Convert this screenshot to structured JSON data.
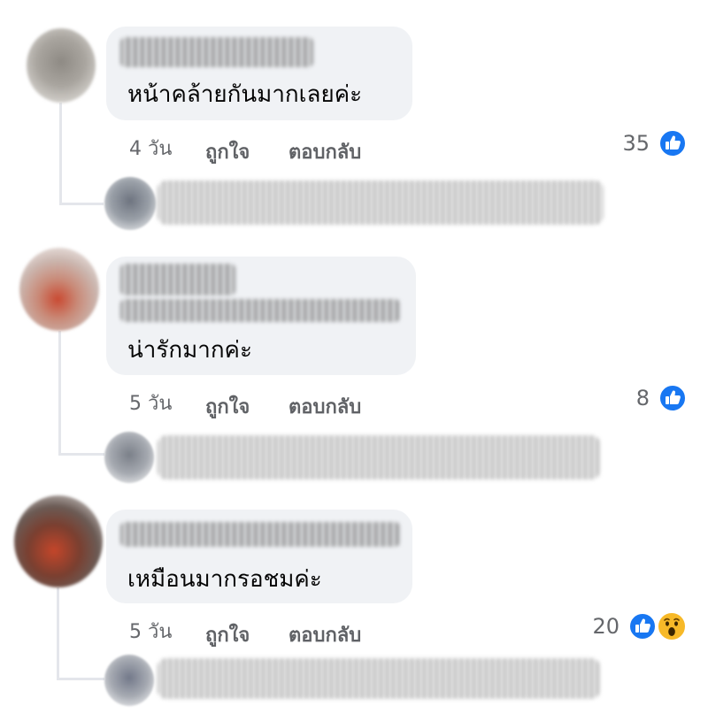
{
  "comments": [
    {
      "text": "หน้าคล้ายกันมากเลยค่ะ",
      "time": "4 วัน",
      "like_label": "ถูกใจ",
      "reply_label": "ตอบกลับ",
      "reaction_count": "35",
      "reactions": [
        "like-icon"
      ]
    },
    {
      "text": "น่ารักมากค่ะ",
      "time": "5 วัน",
      "like_label": "ถูกใจ",
      "reply_label": "ตอบกลับ",
      "reaction_count": "8",
      "reactions": [
        "like-icon"
      ]
    },
    {
      "text": "เหมือนมากรอชมค่ะ",
      "time": "5 วัน",
      "like_label": "ถูกใจ",
      "reply_label": "ตอบกลับ",
      "reaction_count": "20",
      "reactions": [
        "like-icon",
        "wow-icon"
      ]
    }
  ],
  "colors": {
    "bubble": "#f0f2f5",
    "meta_text": "#65676b",
    "like_blue": "#1877f2",
    "wow_yellow": "#f7b928"
  }
}
